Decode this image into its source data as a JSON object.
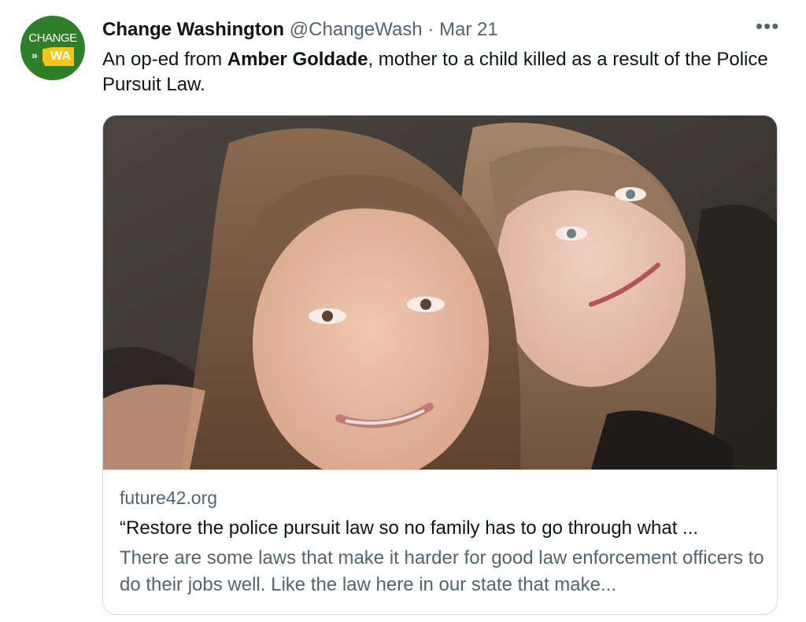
{
  "account": {
    "avatar_text": "CHANGE",
    "avatar_wa": "WA",
    "name": "Change Washington",
    "handle": "@ChangeWash",
    "separator": "·",
    "date": "Mar 21"
  },
  "more_icon": "more-horizontal-icon",
  "more_label": "•••",
  "tweet": {
    "text_before": "An op-ed from ",
    "text_bold": "Amber Goldade",
    "text_after": ", mother to a child killed as a result of the Police Pursuit Law."
  },
  "card": {
    "domain": "future42.org",
    "title": "“Restore the police pursuit law so no family has to go through what ...",
    "description": "There are some laws that make it harder for good law enforcement officers to do their jobs well. Like the law here in our state that make..."
  },
  "colors": {
    "text": "#0f1419",
    "muted": "#536471",
    "border": "#cfd9de",
    "avatar_green": "#2f7f2a",
    "avatar_yellow": "#f5c518"
  }
}
